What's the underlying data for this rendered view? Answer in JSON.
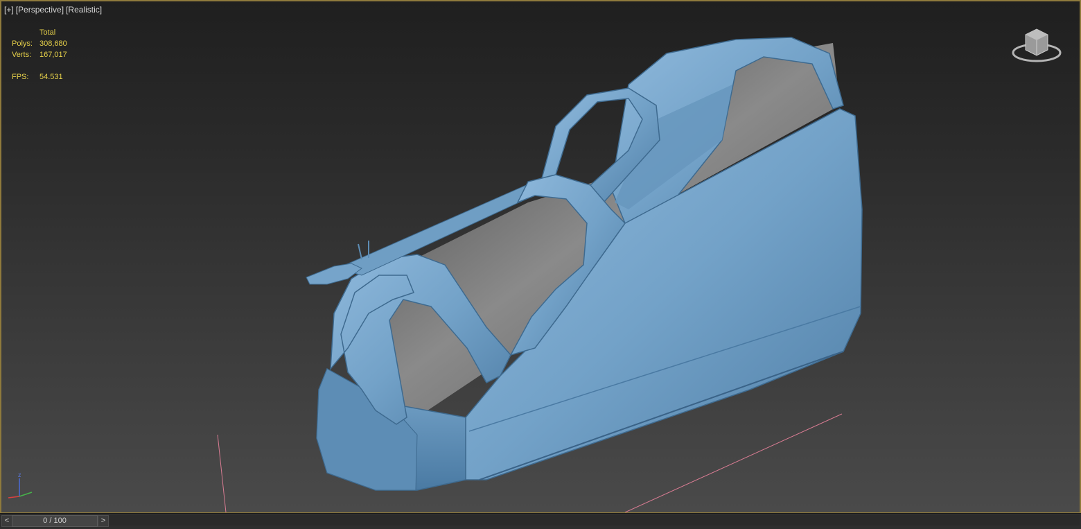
{
  "viewport": {
    "labels": [
      "[+]",
      "[Perspective]",
      "[Realistic]"
    ],
    "stats": {
      "header": "Total",
      "polys_label": "Polys:",
      "polys_value": "308,680",
      "verts_label": "Verts:",
      "verts_value": "167,017",
      "fps_label": "FPS:",
      "fps_value": "54.531"
    },
    "viewcube_icon": "viewcube-icon",
    "axis_label": "z"
  },
  "timeline": {
    "prev_label": "<",
    "next_label": ">",
    "frame_text": "0 / 100"
  },
  "colors": {
    "border": "#8f7a3c",
    "stats_text": "#e8d24a",
    "model_blue": "#6f9ec4"
  }
}
